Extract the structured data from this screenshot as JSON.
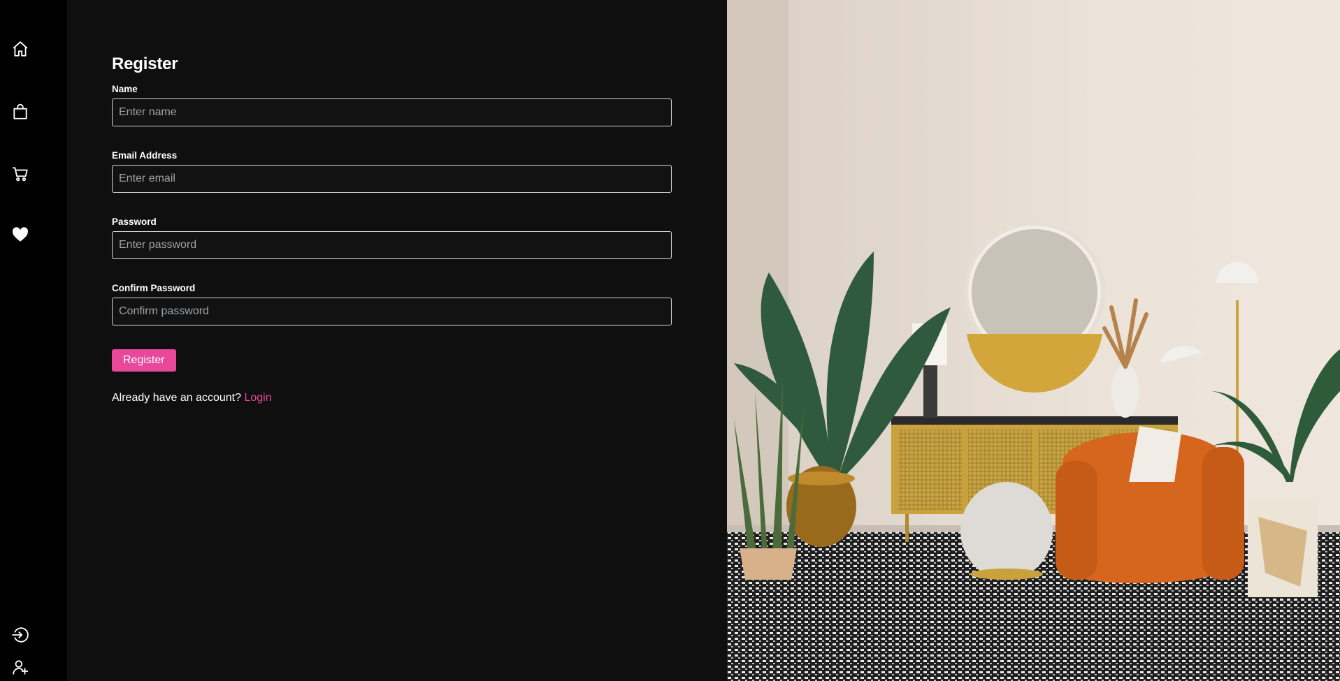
{
  "sidebar": {
    "top_items": [
      {
        "icon": "home-icon"
      },
      {
        "icon": "shopping-bag-icon"
      },
      {
        "icon": "cart-icon"
      },
      {
        "icon": "heart-icon"
      }
    ],
    "bottom_items": [
      {
        "icon": "login-icon"
      },
      {
        "icon": "add-user-icon"
      }
    ]
  },
  "form": {
    "title": "Register",
    "name": {
      "label": "Name",
      "placeholder": "Enter name"
    },
    "email": {
      "label": "Email Address",
      "placeholder": "Enter email"
    },
    "password": {
      "label": "Password",
      "placeholder": "Enter password"
    },
    "confirm": {
      "label": "Confirm Password",
      "placeholder": "Confirm password"
    },
    "submit_label": "Register",
    "account_prompt": "Already have an account?",
    "login_link": "Login"
  },
  "colors": {
    "accent": "#e8479a",
    "sidebar_bg": "#000000",
    "panel_bg": "#0f0f10",
    "input_border": "#d6d6d6"
  }
}
